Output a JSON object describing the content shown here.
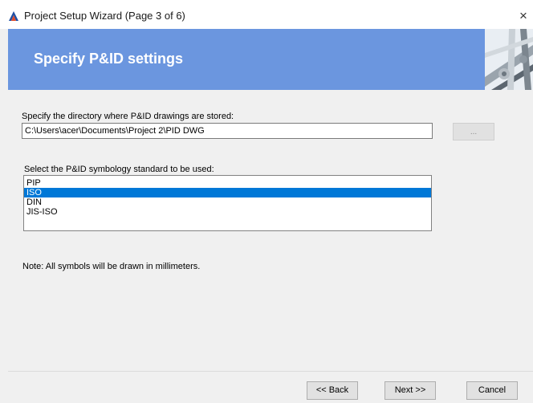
{
  "window": {
    "title": "Project Setup Wizard (Page 3 of 6)",
    "close_glyph": "×"
  },
  "banner": {
    "title": "Specify P&ID settings",
    "color": "#6b96df"
  },
  "directory": {
    "label": "Specify the directory where P&ID drawings are stored:",
    "value": "C:\\Users\\acer\\Documents\\Project 2\\PID DWG",
    "browse_label": "..."
  },
  "symbology": {
    "label": "Select the P&ID symbology standard to be used:",
    "options": [
      "PIP",
      "ISO",
      "DIN",
      "JIS-ISO"
    ],
    "selected": "ISO"
  },
  "note": "Note: All symbols will be drawn in millimeters.",
  "footer": {
    "back_label": "<< Back",
    "next_label": "Next >>",
    "cancel_label": "Cancel"
  },
  "colors": {
    "selection": "#0078d7",
    "window_bg": "#f0f0f0"
  }
}
